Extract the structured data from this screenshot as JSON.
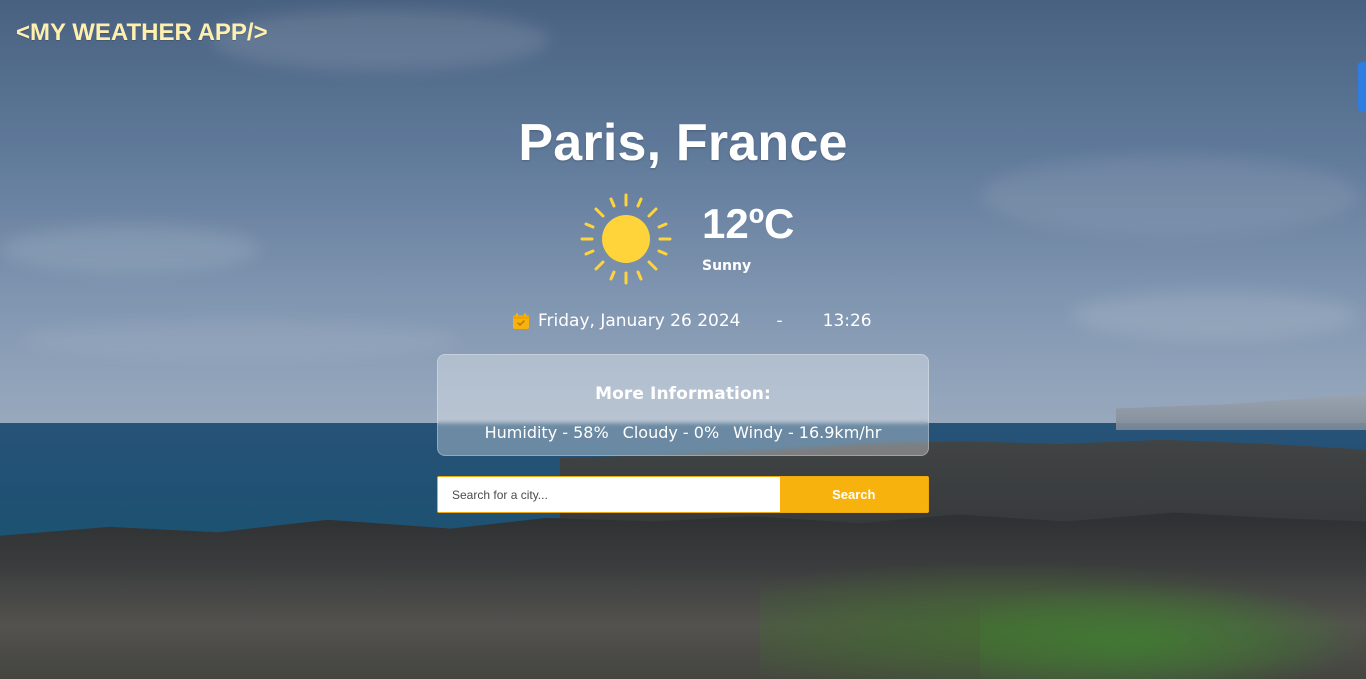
{
  "app": {
    "brand": "<MY WEATHER APP/>"
  },
  "weather": {
    "location": "Paris, France",
    "temperature": "12ºC",
    "condition": "Sunny",
    "date": "Friday, January 26 2024",
    "separator": "-",
    "time": "13:26"
  },
  "more_info": {
    "title": "More Information:",
    "humidity": "Humidity - 58%",
    "cloudy": "Cloudy - 0%",
    "windy": "Windy - 16.9km/hr"
  },
  "search": {
    "placeholder": "Search for a city...",
    "button_label": "Search"
  },
  "icons": {
    "weather": "sun-icon",
    "date": "calendar-icon"
  },
  "colors": {
    "brand_text": "#fff0b0",
    "accent": "#f7b20d",
    "sun": "#ffd43b",
    "text": "#ffffff"
  }
}
